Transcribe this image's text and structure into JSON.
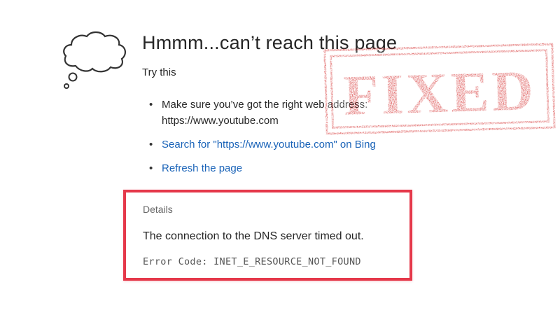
{
  "page": {
    "title": "Hmmm...can’t reach this page",
    "subtitle": "Try this"
  },
  "suggestions": [
    {
      "text_before": "Make sure you’ve got the right web address:",
      "text_after": "https://www.youtube.com"
    },
    {
      "link": "Search for \"https://www.youtube.com\" on Bing"
    },
    {
      "link": "Refresh the page"
    }
  ],
  "details": {
    "label": "Details",
    "message": "The connection to the DNS server timed out.",
    "error_code": "Error Code: INET_E_RESOURCE_NOT_FOUND"
  },
  "stamp": {
    "text": "FIXED",
    "color": "#d42a2a"
  },
  "colors": {
    "link": "#1a63b8",
    "highlight_border": "#e5384a"
  },
  "icons": {
    "thought_cloud": "thought-cloud-icon"
  }
}
